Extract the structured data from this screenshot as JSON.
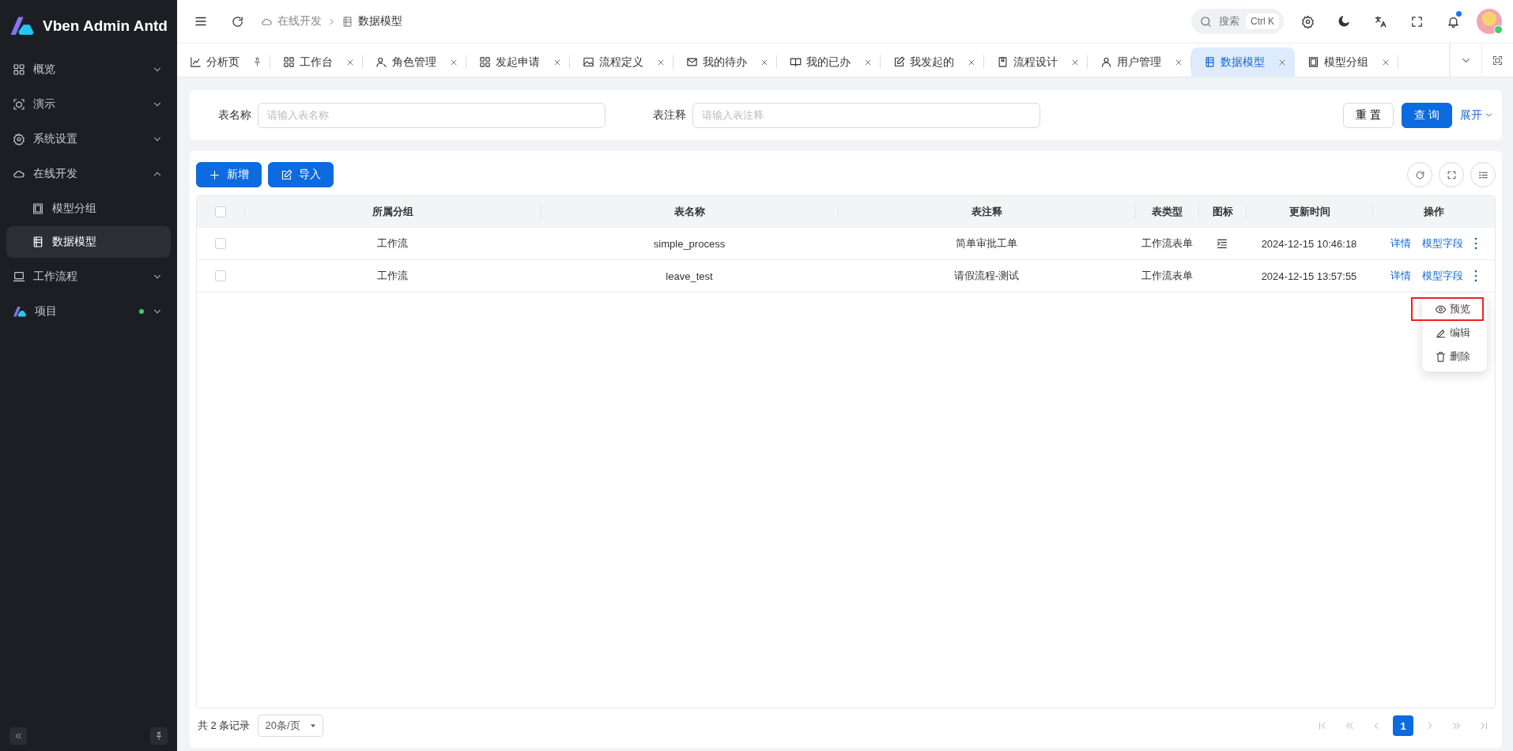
{
  "brand": {
    "name": "Vben Admin Antd"
  },
  "sidebar": {
    "items": [
      {
        "label": "概览",
        "expanded": false
      },
      {
        "label": "演示",
        "expanded": false
      },
      {
        "label": "系统设置",
        "expanded": false
      },
      {
        "label": "在线开发",
        "expanded": true,
        "children": [
          {
            "label": "模型分组",
            "selected": false
          },
          {
            "label": "数据模型",
            "selected": true
          }
        ]
      },
      {
        "label": "工作流程",
        "expanded": false
      },
      {
        "label": "项目",
        "expanded": false,
        "color": "#3ecf6e"
      }
    ]
  },
  "header": {
    "breadcrumb": [
      "在线开发",
      "数据模型"
    ],
    "search": {
      "placeholder": "搜索",
      "shortcut": "Ctrl K"
    },
    "notifications_unread": true
  },
  "tabs": [
    {
      "label": "分析页",
      "kind": "pinned",
      "selected": false
    },
    {
      "label": "工作台",
      "kind": "closable",
      "selected": false
    },
    {
      "label": "角色管理",
      "kind": "closable",
      "selected": false
    },
    {
      "label": "发起申请",
      "kind": "closable",
      "selected": false
    },
    {
      "label": "流程定义",
      "kind": "closable",
      "selected": false
    },
    {
      "label": "我的待办",
      "kind": "closable",
      "selected": false
    },
    {
      "label": "我的已办",
      "kind": "closable",
      "selected": false
    },
    {
      "label": "我发起的",
      "kind": "closable",
      "selected": false
    },
    {
      "label": "流程设计",
      "kind": "closable",
      "selected": false
    },
    {
      "label": "用户管理",
      "kind": "closable",
      "selected": false
    },
    {
      "label": "数据模型",
      "kind": "closable",
      "selected": true
    },
    {
      "label": "模型分组",
      "kind": "closable",
      "selected": false
    }
  ],
  "filters": [
    {
      "label": "表名称",
      "placeholder": "请输入表名称"
    },
    {
      "label": "表注释",
      "placeholder": "请输入表注释"
    }
  ],
  "filter_buttons": {
    "reset": "重 置",
    "query": "查 询",
    "expand": "展开"
  },
  "toolbar": {
    "add": "新增",
    "import": "导入"
  },
  "table": {
    "select_all_checked": false,
    "columns": [
      "所属分组",
      "表名称",
      "表注释",
      "表类型",
      "图标",
      "更新时间",
      "操作"
    ],
    "rows": [
      {
        "group": "工作流",
        "name": "simple_process",
        "comment": "简单审批工单",
        "type": "工作流表单",
        "icon_shown": true,
        "updated": "2024-12-15 10:46:18",
        "actions": [
          "详情",
          "模型字段"
        ],
        "checked": false
      },
      {
        "group": "工作流",
        "name": "leave_test",
        "comment": "请假流程-测试",
        "type": "工作流表单",
        "icon_shown": false,
        "updated": "2024-12-15 13:57:55",
        "actions": [
          "详情",
          "模型字段"
        ],
        "checked": false
      }
    ]
  },
  "row_menu": {
    "items": [
      {
        "label": "预览",
        "highlighted": true
      },
      {
        "label": "编辑",
        "highlighted": false
      },
      {
        "label": "删除",
        "highlighted": false
      }
    ]
  },
  "footer": {
    "total": "共 2 条记录",
    "page_size": "20条/页",
    "pages": [
      {
        "label": "1",
        "selected": true
      }
    ]
  }
}
